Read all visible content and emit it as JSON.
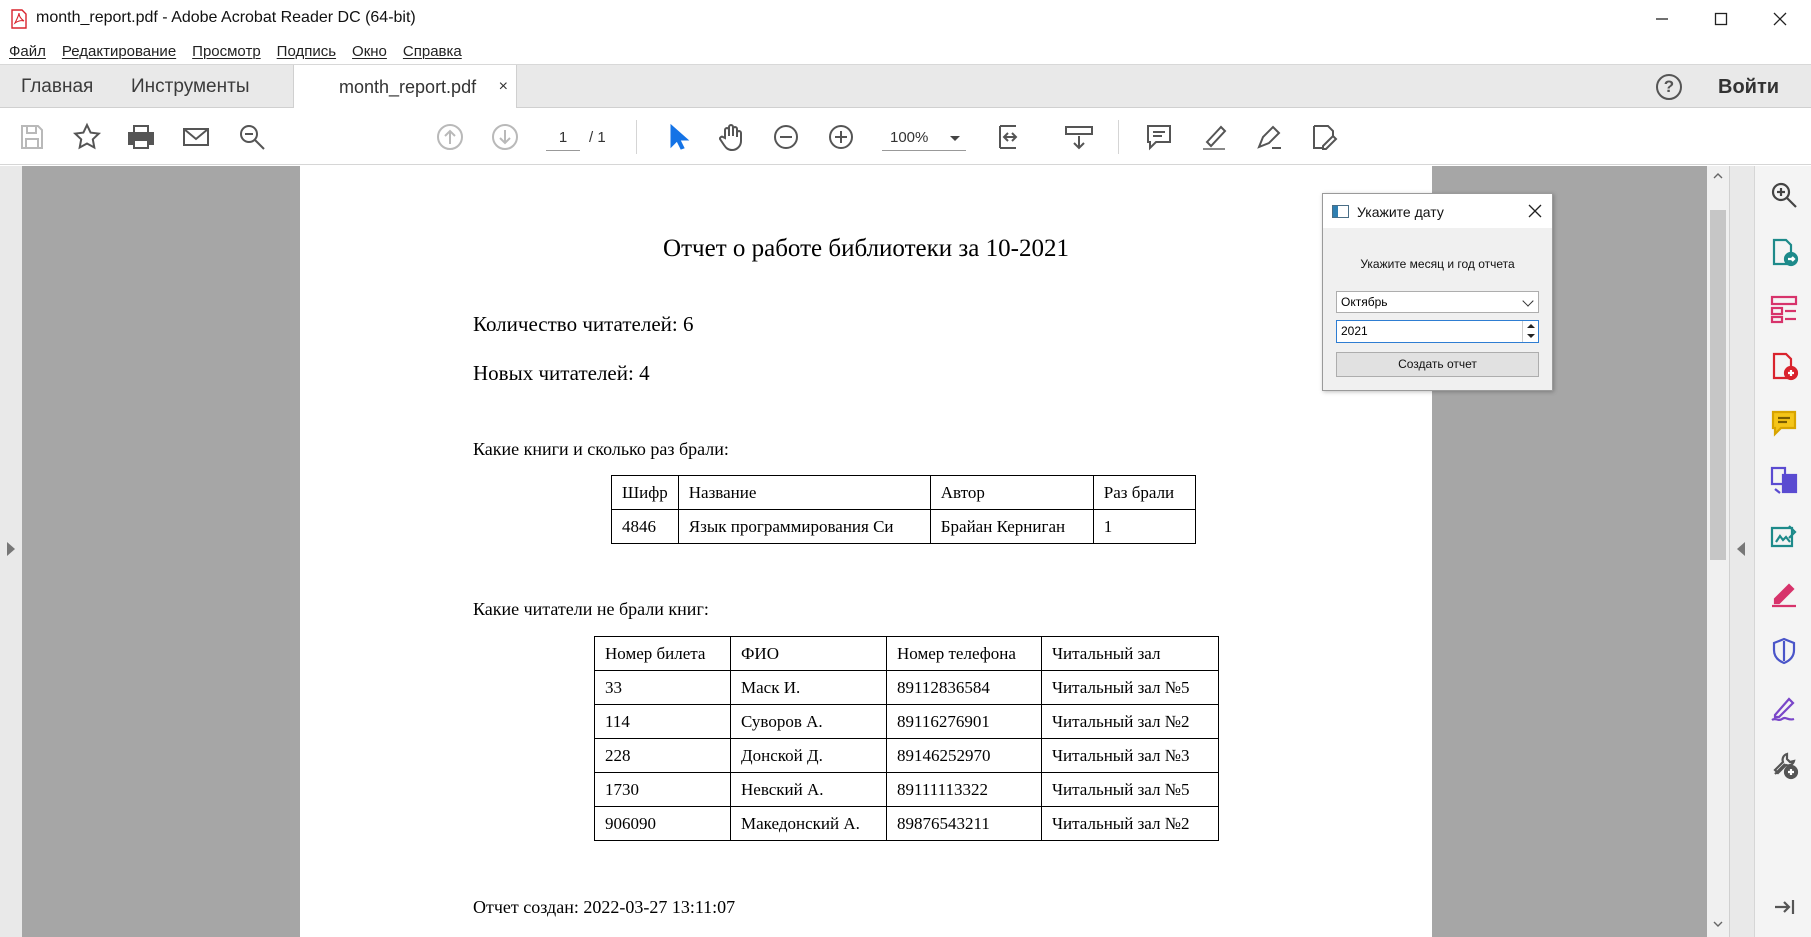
{
  "window": {
    "title": "month_report.pdf - Adobe Acrobat Reader DC (64-bit)"
  },
  "menu": {
    "items": [
      "Файл",
      "Редактирование",
      "Просмотр",
      "Подпись",
      "Окно",
      "Справка"
    ]
  },
  "tabs": {
    "home": "Главная",
    "tools": "Инструменты",
    "document": "month_report.pdf",
    "close_symbol": "×",
    "help_symbol": "?",
    "login": "Войти"
  },
  "toolbar": {
    "page_current": "1",
    "page_total": "/ 1",
    "zoom": "100%"
  },
  "document": {
    "title": "Отчет о работе библиотеки за 10-2021",
    "readers_count": "Количество читателей: 6",
    "new_readers": "Новых читателей: 4",
    "books_heading": "Какие книги и сколько раз брали:",
    "books_table": {
      "headers": [
        "Шифр",
        "Название",
        "Автор",
        "Раз брали"
      ],
      "rows": [
        [
          "4846",
          "Язык программирования Си",
          "Брайан Керниган",
          "1"
        ]
      ]
    },
    "readers_heading": "Какие читатели не брали книг:",
    "readers_table": {
      "headers": [
        "Номер билета",
        "ФИО",
        "Номер телефона",
        "Читальный зал"
      ],
      "rows": [
        [
          "33",
          "Маск И.",
          "89112836584",
          "Читальный зал №5"
        ],
        [
          "114",
          "Суворов А.",
          "89116276901",
          "Читальный зал №2"
        ],
        [
          "228",
          "Донской Д.",
          "89146252970",
          "Читальный зал №3"
        ],
        [
          "1730",
          "Невский А.",
          "89111113322",
          "Читальный зал №5"
        ],
        [
          "906090",
          "Македонский А.",
          "89876543211",
          "Читальный зал №2"
        ]
      ]
    },
    "created": "Отчет создан: 2022-03-27 13:11:07"
  },
  "dialog": {
    "title": "Укажите дату",
    "prompt": "Укажите месяц и год отчета",
    "month": "Октябрь",
    "year": "2021",
    "button": "Создать отчет"
  },
  "colors": {
    "acrobat_red": "#d9232d",
    "select_blue": "#1473e6",
    "workspace_gray": "#a6a6a6"
  }
}
